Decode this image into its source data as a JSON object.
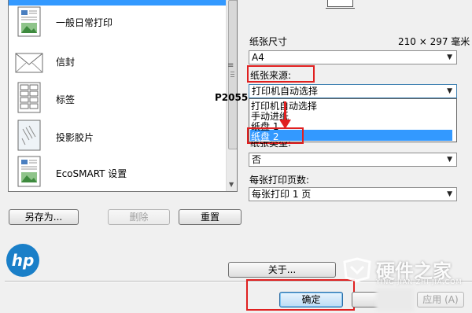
{
  "presets": {
    "items": [
      {
        "label": "一般日常打印",
        "icon": "document-icon"
      },
      {
        "label": "信封",
        "icon": "envelope-icon"
      },
      {
        "label": "标签",
        "icon": "labels-sheet-icon"
      },
      {
        "label": "投影胶片",
        "icon": "transparency-icon"
      },
      {
        "label": "EcoSMART 设置",
        "icon": "ecosmart-document-icon"
      }
    ]
  },
  "printer_model": "P2055",
  "buttons": {
    "save_as": "另存为...",
    "delete": "删除",
    "reset": "重置",
    "about": "关于...",
    "ok": "确定",
    "apply": "应用 (A)"
  },
  "paper_size": {
    "label": "纸张尺寸",
    "dimensions": "210 × 297 毫米",
    "value": "A4"
  },
  "paper_source": {
    "label": "纸张来源:",
    "value": "打印机自动选择",
    "options": [
      "打印机自动选择",
      "手动进纸",
      "纸盘 1",
      "纸盘 2"
    ],
    "highlighted_index": 3
  },
  "paper_type": {
    "label": "纸张类型:",
    "value": "否"
  },
  "pages_per_sheet": {
    "label": "每张打印页数:",
    "value": "每张打印 1 页"
  },
  "brand": {
    "logo_text": "hp"
  },
  "watermark": {
    "title": "硬件之家",
    "url": "YING JIAN ZHI JIA.COM"
  },
  "colors": {
    "selection": "#3399ff",
    "annotation_red": "#e02020",
    "hp_blue": "#1a7fc8"
  }
}
